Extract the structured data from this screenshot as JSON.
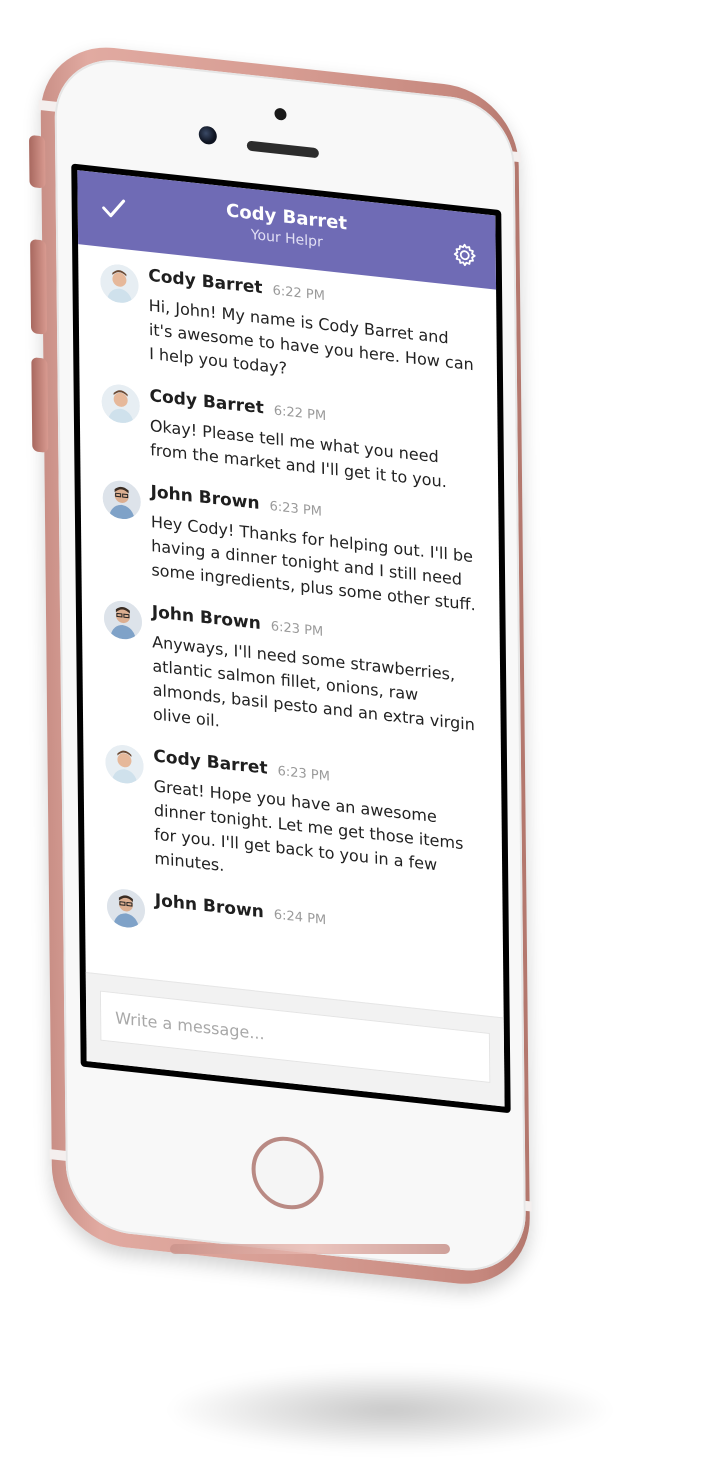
{
  "header": {
    "title": "Cody Barret",
    "subtitle": "Your Helpr",
    "left_icon": "check-icon",
    "right_icon": "gear-icon",
    "color": "#6f6bb5"
  },
  "messages": [
    {
      "sender": "Cody Barret",
      "time": "6:22 PM",
      "text": "Hi, John! My name is Cody Barret and it's awesome to have you here. How can I help you today?"
    },
    {
      "sender": "Cody Barret",
      "time": "6:22 PM",
      "text": "Okay! Please tell me what you need from the market and I'll get it to you."
    },
    {
      "sender": "John Brown",
      "time": "6:23 PM",
      "text": "Hey Cody! Thanks for helping out. I'll be having a dinner tonight and I still need some ingredients, plus some other stuff."
    },
    {
      "sender": "John Brown",
      "time": "6:23 PM",
      "text": "Anyways, I'll need some strawberries, atlantic salmon fillet, onions, raw almonds, basil pesto and an extra virgin olive oil."
    },
    {
      "sender": "Cody Barret",
      "time": "6:23 PM",
      "text": "Great! Hope you have an awesome dinner tonight. Let me get those items for you. I'll get back to you in a few minutes."
    },
    {
      "sender": "John Brown",
      "time": "6:24 PM",
      "text": ""
    }
  ],
  "composer": {
    "placeholder": "Write a message..."
  },
  "device": {
    "body_color": "#d79d93"
  }
}
